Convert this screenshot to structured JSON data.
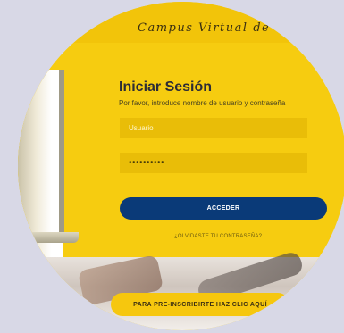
{
  "header": {
    "banner_text": "Campus Virtual de"
  },
  "login": {
    "title": "Iniciar Sesión",
    "subtitle": "Por favor, introduce nombre de usuario y contraseña",
    "username_placeholder": "Usuario",
    "password_value": "••••••••••",
    "submit_label": "ACCEDER",
    "forgot_label": "¿OLVIDASTE TU CONTRASEÑA?"
  },
  "footer": {
    "preregister_label": "PARA PRE-INSCRIBIRTE HAZ CLIC AQUÍ"
  },
  "colors": {
    "brand_yellow": "#f5cb0e",
    "button_blue": "#0a3a78",
    "page_bg": "#d8d8e6"
  }
}
